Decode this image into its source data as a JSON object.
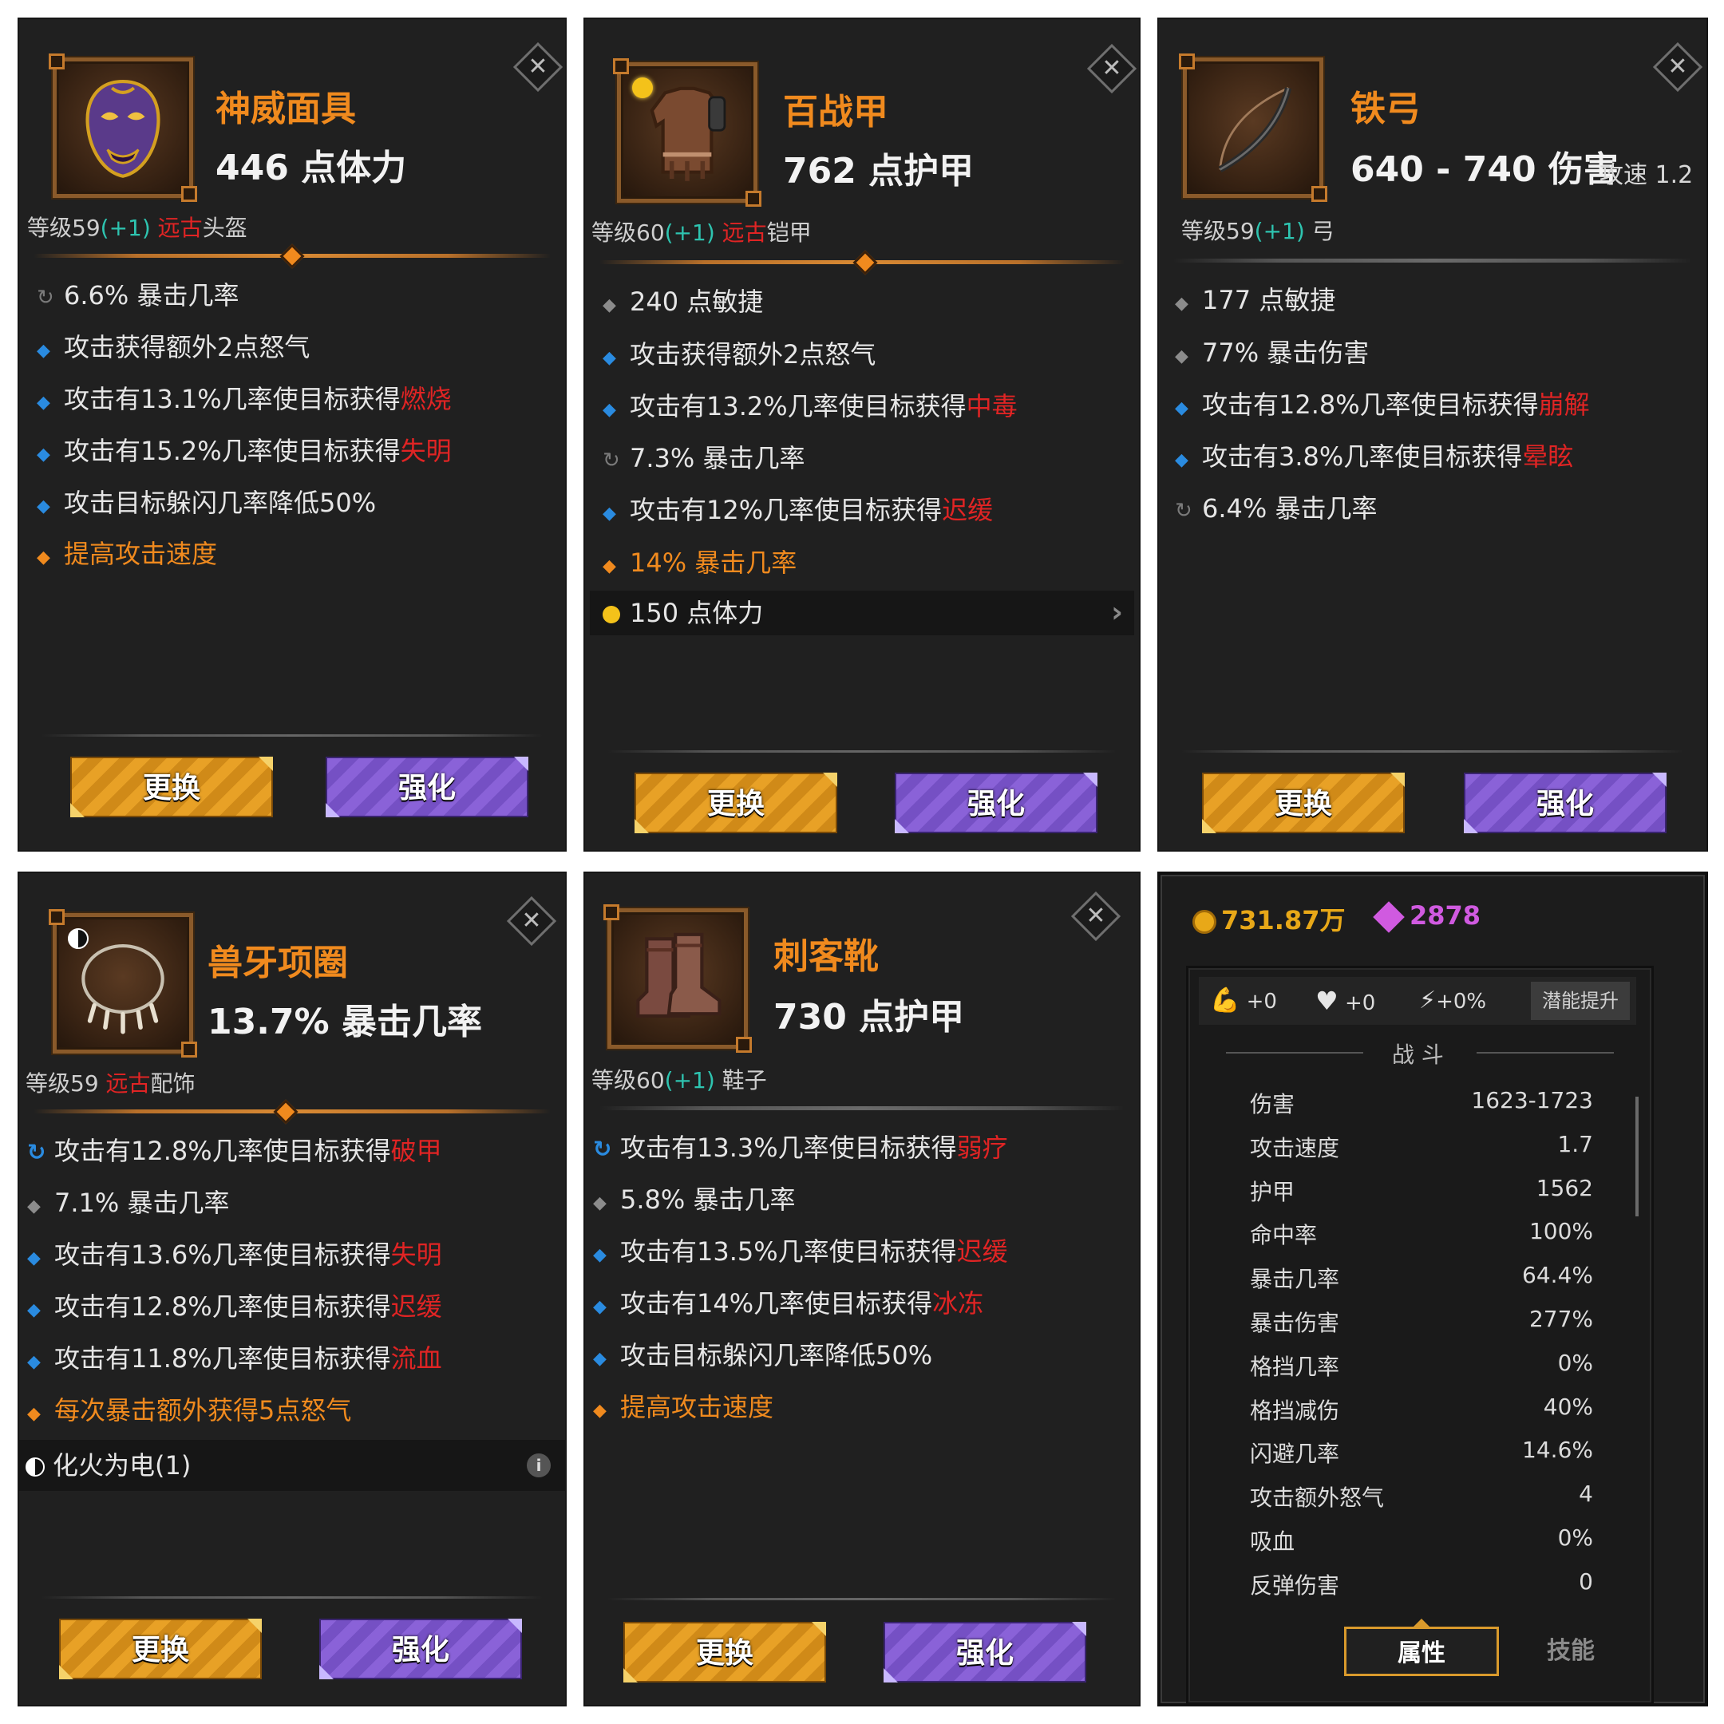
{
  "cards": [
    {
      "name": "神威面具",
      "main_stat": "446 点体力",
      "meta": {
        "level": "等级59",
        "bonus": "(+1)",
        "rarity": "远古",
        "slot": "头盔"
      },
      "affixes": [
        {
          "bullet": "cycle",
          "text": "6.6% 暴击几率",
          "kw": ""
        },
        {
          "bullet": "blue",
          "text": "攻击获得额外2点怒气",
          "kw": ""
        },
        {
          "bullet": "blue",
          "text": "攻击有13.1%几率使目标获得",
          "kw": "燃烧"
        },
        {
          "bullet": "blue",
          "text": "攻击有15.2%几率使目标获得",
          "kw": "失明"
        },
        {
          "bullet": "blue",
          "text": "攻击目标躲闪几率降低50%",
          "kw": ""
        },
        {
          "bullet": "orange",
          "text": "提高攻击速度",
          "kw": ""
        }
      ],
      "buttons": {
        "swap": "更换",
        "enhance": "强化"
      },
      "close": "✕"
    },
    {
      "name": "百战甲",
      "main_stat": "762 点护甲",
      "meta": {
        "level": "等级60",
        "bonus": "(+1)",
        "rarity": "远古",
        "slot": "铠甲"
      },
      "affixes": [
        {
          "bullet": "gray",
          "text": "240 点敏捷",
          "kw": ""
        },
        {
          "bullet": "blue",
          "text": "攻击获得额外2点怒气",
          "kw": ""
        },
        {
          "bullet": "blue",
          "text": "攻击有13.2%几率使目标获得",
          "kw": "中毒"
        },
        {
          "bullet": "cycle",
          "text": "7.3% 暴击几率",
          "kw": ""
        },
        {
          "bullet": "blue",
          "text": "攻击有12%几率使目标获得",
          "kw": "迟缓"
        },
        {
          "bullet": "orange",
          "text": "14% 暴击几率",
          "kw": ""
        },
        {
          "bullet": "gem",
          "text": "150 点体力",
          "kw": ""
        }
      ],
      "buttons": {
        "swap": "更换",
        "enhance": "强化"
      },
      "close": "✕"
    },
    {
      "name": "铁弓",
      "main_stat": "640 - 740 伤害",
      "speed": "攻速 1.2",
      "meta": {
        "level": "等级59",
        "bonus": "(+1)",
        "rarity": "",
        "slot": "弓"
      },
      "affixes": [
        {
          "bullet": "gray",
          "text": "177 点敏捷",
          "kw": ""
        },
        {
          "bullet": "gray",
          "text": "77% 暴击伤害",
          "kw": ""
        },
        {
          "bullet": "blue",
          "text": "攻击有12.8%几率使目标获得",
          "kw": "崩解"
        },
        {
          "bullet": "blue",
          "text": "攻击有3.8%几率使目标获得",
          "kw": "晕眩"
        },
        {
          "bullet": "cycle",
          "text": "6.4% 暴击几率",
          "kw": ""
        }
      ],
      "buttons": {
        "swap": "更换",
        "enhance": "强化"
      },
      "close": "✕"
    },
    {
      "name": "兽牙项圈",
      "main_stat": "13.7% 暴击几率",
      "meta": {
        "level": "等级59 ",
        "bonus": "",
        "rarity": "远古",
        "slot": "配饰"
      },
      "affixes": [
        {
          "bullet": "cycle-blue",
          "text": "攻击有12.8%几率使目标获得",
          "kw": "破甲"
        },
        {
          "bullet": "gray",
          "text": "7.1% 暴击几率",
          "kw": ""
        },
        {
          "bullet": "blue",
          "text": "攻击有13.6%几率使目标获得",
          "kw": "失明"
        },
        {
          "bullet": "blue",
          "text": "攻击有12.8%几率使目标获得",
          "kw": "迟缓"
        },
        {
          "bullet": "blue",
          "text": "攻击有11.8%几率使目标获得",
          "kw": "流血"
        },
        {
          "bullet": "orange",
          "text": "每次暴击额外获得5点怒气",
          "kw": ""
        },
        {
          "bullet": "yin",
          "text": "化火为电(1)",
          "kw": ""
        }
      ],
      "buttons": {
        "swap": "更换",
        "enhance": "强化"
      },
      "close": "✕",
      "info": "i"
    },
    {
      "name": "刺客靴",
      "main_stat": "730 点护甲",
      "meta": {
        "level": "等级60",
        "bonus": "(+1)",
        "rarity": "",
        "slot": " 鞋子"
      },
      "affixes": [
        {
          "bullet": "cycle-blue",
          "text": "攻击有13.3%几率使目标获得",
          "kw": "弱疗"
        },
        {
          "bullet": "gray",
          "text": "5.8% 暴击几率",
          "kw": ""
        },
        {
          "bullet": "blue",
          "text": "攻击有13.5%几率使目标获得",
          "kw": "迟缓"
        },
        {
          "bullet": "blue",
          "text": "攻击有14%几率使目标获得",
          "kw": "冰冻"
        },
        {
          "bullet": "blue",
          "text": "攻击目标躲闪几率降低50%",
          "kw": ""
        },
        {
          "bullet": "orange",
          "text": "提高攻击速度",
          "kw": ""
        }
      ],
      "buttons": {
        "swap": "更换",
        "enhance": "强化"
      },
      "close": "✕"
    }
  ],
  "stats_panel": {
    "gold": "731.87万",
    "gems": "2878",
    "potential": [
      {
        "icon": "strength-icon",
        "value": "+0"
      },
      {
        "icon": "heart-icon",
        "value": "+0"
      },
      {
        "icon": "lightning-icon",
        "value": "+0%"
      }
    ],
    "potential_button": "潜能提升",
    "section_title": "战 斗",
    "stats": [
      {
        "label": "伤害",
        "value": "1623-1723"
      },
      {
        "label": "攻击速度",
        "value": "1.7"
      },
      {
        "label": "护甲",
        "value": "1562"
      },
      {
        "label": "命中率",
        "value": "100%"
      },
      {
        "label": "暴击几率",
        "value": "64.4%"
      },
      {
        "label": "暴击伤害",
        "value": "277%"
      },
      {
        "label": "格挡几率",
        "value": "0%"
      },
      {
        "label": "格挡减伤",
        "value": "40%"
      },
      {
        "label": "闪避几率",
        "value": "14.6%"
      },
      {
        "label": "攻击额外怒气",
        "value": "4"
      },
      {
        "label": "吸血",
        "value": "0%"
      },
      {
        "label": "反弹伤害",
        "value": "0"
      }
    ],
    "tabs": {
      "attributes": "属性",
      "skills": "技能"
    }
  },
  "colors": {
    "name_orange": "#f08a1e",
    "keyword_red": "#e02424",
    "bonus_teal": "#2ec4b0",
    "bullet_blue": "#2a8be0",
    "gold": "#e8a818",
    "gem_purple": "#d05ae0"
  }
}
